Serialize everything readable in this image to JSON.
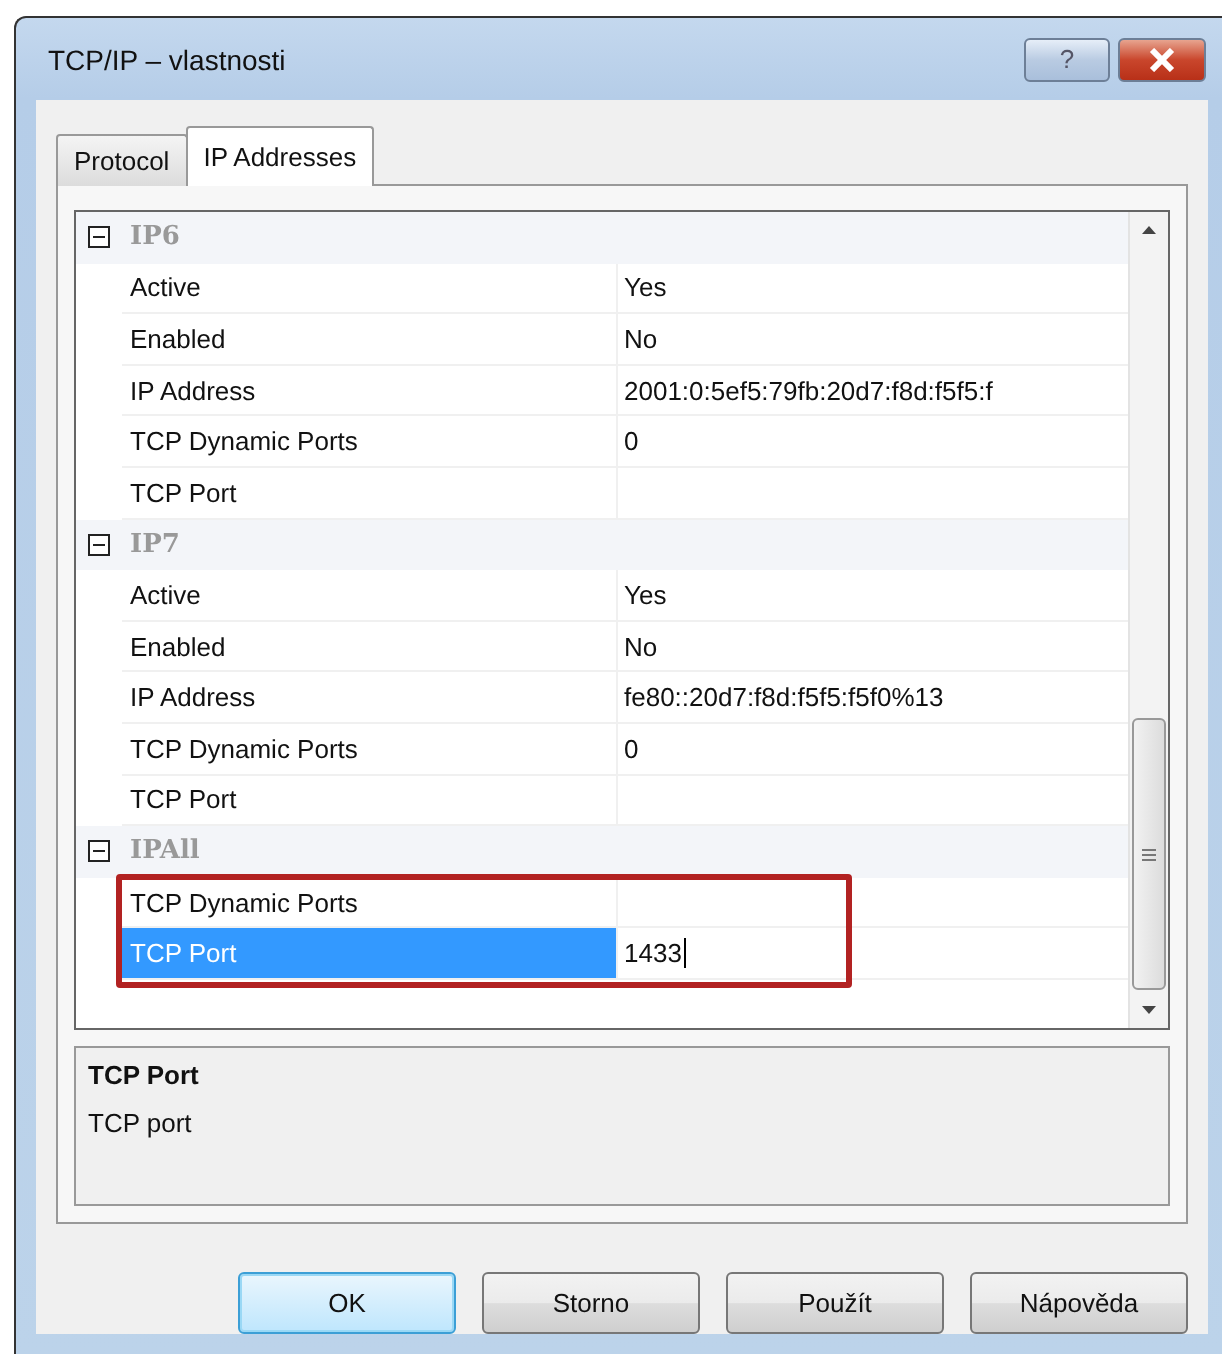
{
  "window": {
    "title": "TCP/IP – vlastnosti",
    "help_button": "?"
  },
  "tabs": [
    {
      "label": "Protocol",
      "selected": false
    },
    {
      "label": "IP Addresses",
      "selected": true
    }
  ],
  "grid": {
    "sections": [
      {
        "name": "IP6",
        "expanded": true,
        "outlined": false,
        "rows": [
          {
            "name": "Active",
            "value": "Yes",
            "selected": false
          },
          {
            "name": "Enabled",
            "value": "No",
            "selected": false
          },
          {
            "name": "IP Address",
            "value": "2001:0:5ef5:79fb:20d7:f8d:f5f5:f",
            "selected": false
          },
          {
            "name": "TCP Dynamic Ports",
            "value": "0",
            "selected": false
          },
          {
            "name": "TCP Port",
            "value": "",
            "selected": false
          }
        ]
      },
      {
        "name": "IP7",
        "expanded": true,
        "outlined": false,
        "rows": [
          {
            "name": "Active",
            "value": "Yes",
            "selected": false
          },
          {
            "name": "Enabled",
            "value": "No",
            "selected": false
          },
          {
            "name": "IP Address",
            "value": "fe80::20d7:f8d:f5f5:f5f0%13",
            "selected": false
          },
          {
            "name": "TCP Dynamic Ports",
            "value": "0",
            "selected": false
          },
          {
            "name": "TCP Port",
            "value": "",
            "selected": false
          }
        ]
      },
      {
        "name": "IPAll",
        "expanded": true,
        "outlined": true,
        "rows": [
          {
            "name": "TCP Dynamic Ports",
            "value": "",
            "selected": false
          },
          {
            "name": "TCP Port",
            "value": "1433",
            "selected": true
          }
        ]
      }
    ]
  },
  "description": {
    "title": "TCP Port",
    "text": "TCP port"
  },
  "buttons": [
    {
      "label": "OK",
      "default": true
    },
    {
      "label": "Storno",
      "default": false
    },
    {
      "label": "Použít",
      "default": false
    },
    {
      "label": "Nápověda",
      "default": false
    }
  ]
}
